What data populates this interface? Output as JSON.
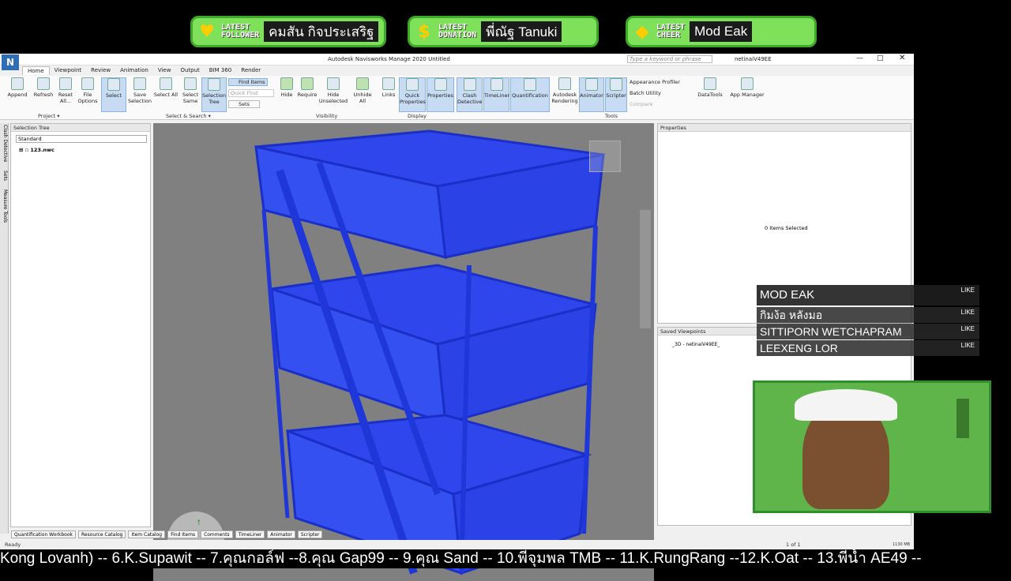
{
  "overlay": {
    "alerts": [
      {
        "kind_top": "LATEST",
        "kind_bottom": "FOLLOWER",
        "icon": "heart-icon",
        "value": "คมสัน กิจประเสริฐ"
      },
      {
        "kind_top": "LATEST",
        "kind_bottom": "DONATION",
        "icon": "dollar-icon",
        "value": "พี่ณัฐ Tanuki"
      },
      {
        "kind_top": "LATEST",
        "kind_bottom": "CHEER",
        "icon": "diamond-icon",
        "value": "Mod Eak"
      }
    ],
    "chat": [
      {
        "name": "MOD EAK",
        "like": "LIKE"
      },
      {
        "name": "กิมง้อ หลังมอ",
        "like": "LIKE"
      },
      {
        "name": "SITTIPORN WETCHAPRAM",
        "like": "LIKE"
      },
      {
        "name": "LEEXENG LOR",
        "like": "LIKE"
      }
    ],
    "ticker": "Kong Lovanh) -- 6.K.Supawit -- 7.คุณกอล์ฟ --8.คุณ Gap99 -- 9.คุณ Sand -- 10.พี่จุมพล TMB -- 11.K.RungRang --12.K.Oat -- 13.พี่น้ำ AE49 --"
  },
  "app": {
    "title": "Autodesk Navisworks Manage 2020   Untitled",
    "search_placeholder": "Type a keyword or phrase",
    "user": "netinaiV49EE",
    "logo": "N",
    "tabs": [
      "Home",
      "Viewpoint",
      "Review",
      "Animation",
      "View",
      "Output",
      "BIM 360",
      "Render"
    ],
    "ribbon": {
      "project": [
        "Append",
        "Refresh",
        "Reset All...",
        "File Options"
      ],
      "select": [
        "Select",
        "Save Selection",
        "Select All",
        "Select Same",
        "Selection Tree"
      ],
      "find_items": "Find Items",
      "quick_find": "Quick Find",
      "sets": "Sets",
      "visibility": [
        "Hide",
        "Require",
        "Hide Unselected",
        "Unhide All"
      ],
      "display": [
        "Links",
        "Quick Properties",
        "Properties"
      ],
      "tools": [
        "Clash Detective",
        "TimeLiner",
        "Quantification",
        "Autodesk Rendering",
        "Animator",
        "Scripter"
      ],
      "tools_small": [
        "Appearance Profiler",
        "Batch Utility",
        "Compare"
      ],
      "extra": [
        "DataTools",
        "App Manager"
      ],
      "groups": [
        "Project ▾",
        "Select & Search ▾",
        "Visibility",
        "Display",
        "Tools"
      ]
    },
    "selection_tree": {
      "title": "Selection Tree",
      "mode": "Standard",
      "item": "123.nwc"
    },
    "side_tabs": [
      "Clash Detective",
      "Sets",
      "Measure Tools"
    ],
    "properties": {
      "title": "Properties",
      "empty": "0 Items Selected"
    },
    "saved_viewpoints": {
      "title": "Saved Viewpoints",
      "item": "_3D - netinaiV49EE_"
    },
    "bottom_tabs": [
      "Quantification Workbook",
      "Resource Catalog",
      "Item Catalog",
      "Find Items",
      "Comments",
      "TimeLiner",
      "Animator",
      "Scripter"
    ],
    "status": "Ready",
    "page": "1 of 1",
    "memory": "1130 MB"
  }
}
